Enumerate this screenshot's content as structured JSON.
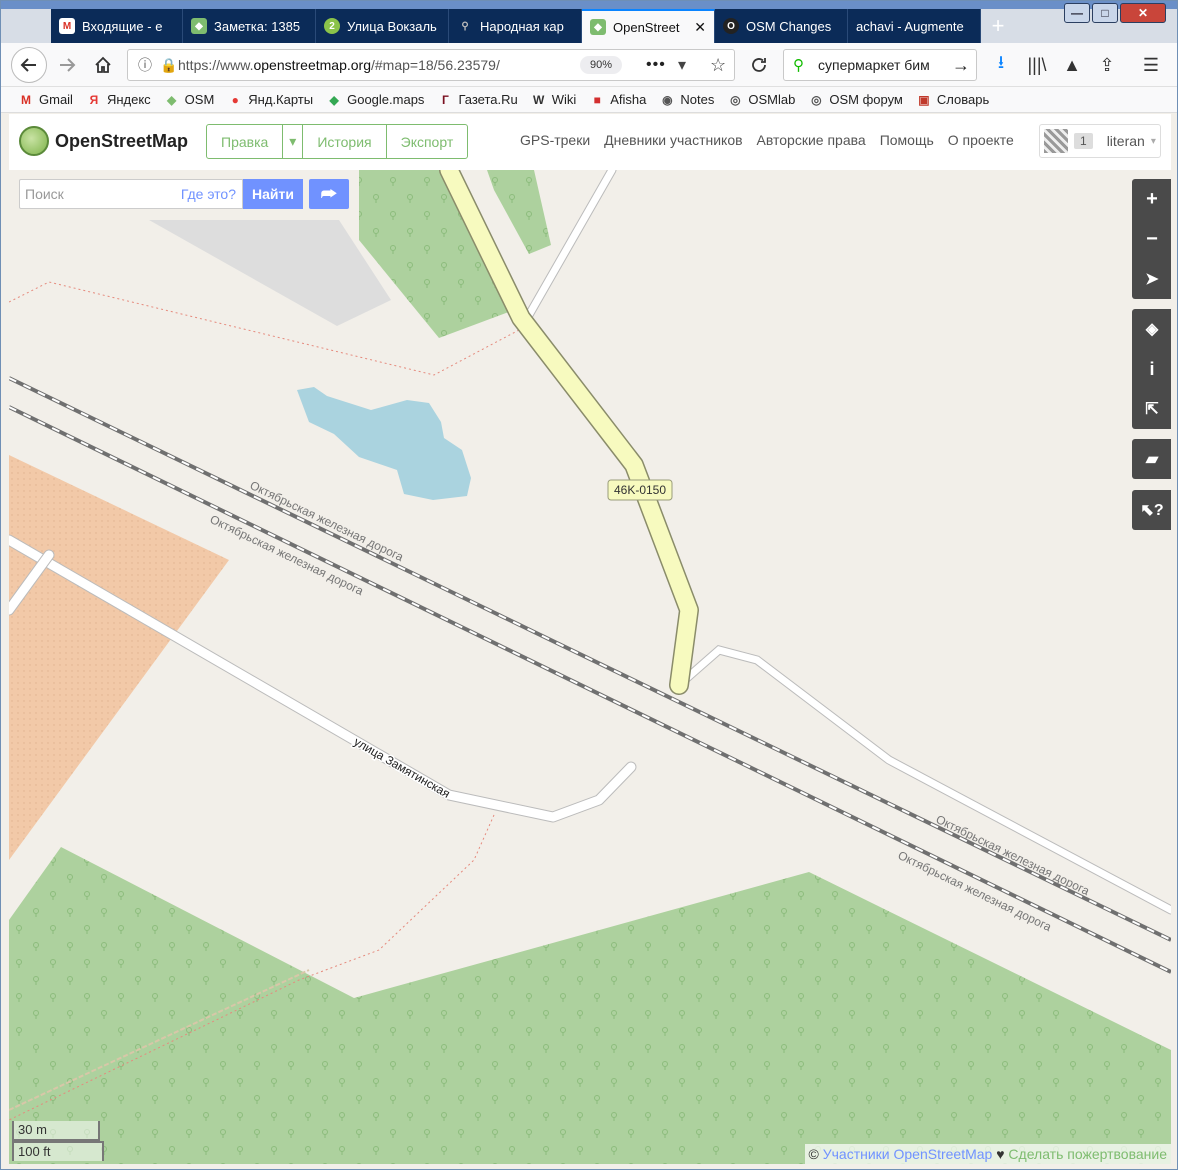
{
  "browser": {
    "tabs": [
      {
        "title": "Входящие - e",
        "icon": "gmail-icon",
        "color": "#d93025",
        "active": false
      },
      {
        "title": "Заметка: 1385",
        "icon": "osm-icon",
        "color": "#7ebc6f",
        "active": false
      },
      {
        "title": "Улица Вокзаль",
        "icon": "twogis-icon",
        "color": "#8bc34a",
        "active": false
      },
      {
        "title": "Народная кар",
        "icon": "pin-icon",
        "color": "#888888",
        "active": false
      },
      {
        "title": "OpenStreet",
        "icon": "osm-icon",
        "color": "#7ebc6f",
        "active": true
      },
      {
        "title": "OSM Changes",
        "icon": "osmcha-icon",
        "color": "#222222",
        "active": false
      },
      {
        "title": "achavi - Augmente",
        "icon": "blank-icon",
        "color": "#0b2b58",
        "active": false
      }
    ],
    "new_tab_symbol": "+",
    "window_buttons": {
      "minimize": "—",
      "maximize": "□",
      "close": "✕"
    },
    "url_prefix": "https://www.",
    "url_host": "openstreetmap.org",
    "url_rest": "/#map=18/56.23579/",
    "zoom": "90%",
    "search_value": "супермаркет бим",
    "bookmarks": [
      {
        "label": "Gmail",
        "icon": "gmail-icon",
        "glyph": "M",
        "color": "#d93025"
      },
      {
        "label": "Яндекс",
        "icon": "yandex-icon",
        "glyph": "Я",
        "color": "#e53935"
      },
      {
        "label": "OSM",
        "icon": "osm-icon",
        "glyph": "◆",
        "color": "#7ebc6f"
      },
      {
        "label": "Янд.Карты",
        "icon": "map-pin-icon",
        "glyph": "●",
        "color": "#e53935"
      },
      {
        "label": "Google.maps",
        "icon": "google-maps-icon",
        "glyph": "◆",
        "color": "#34a853"
      },
      {
        "label": "Газета.Ru",
        "icon": "gazeta-icon",
        "glyph": "Г",
        "color": "#7a1020"
      },
      {
        "label": "Wiki",
        "icon": "wikipedia-icon",
        "glyph": "W",
        "color": "#333333"
      },
      {
        "label": "Afisha",
        "icon": "afisha-icon",
        "glyph": "■",
        "color": "#d32f2f"
      },
      {
        "label": "Notes",
        "icon": "rss-icon",
        "glyph": "◉",
        "color": "#555555"
      },
      {
        "label": "OSMlab",
        "icon": "globe-icon",
        "glyph": "◎",
        "color": "#555555"
      },
      {
        "label": "OSM форум",
        "icon": "globe-icon",
        "glyph": "◎",
        "color": "#555555"
      },
      {
        "label": "Словарь",
        "icon": "dictionary-icon",
        "glyph": "▣",
        "color": "#c0392b"
      }
    ]
  },
  "osm": {
    "brand": "OpenStreetMap",
    "edit": "Правка",
    "history": "История",
    "export": "Экспорт",
    "nav": [
      "GPS-треки",
      "Дневники участников",
      "Авторские права",
      "Помощь",
      "О проекте"
    ],
    "user_count": "1",
    "username": "literan",
    "search_placeholder": "Поиск",
    "where_is_this": "Где это?",
    "go": "Найти"
  },
  "map": {
    "road_ref": "46K-0150",
    "railway_labels": [
      "Октябрьская железная дорога",
      "Октябрьская железная дорога",
      "Октябрьская железная дорога",
      "Октябрьская железная дорога"
    ],
    "street_label": "улица Замятинская",
    "scale_metric": "30 m",
    "scale_imperial": "100 ft",
    "attrib_symbol": "©",
    "attrib_contributors": "Участники OpenStreetMap",
    "attrib_heart": "♥",
    "attrib_donate": "Сделать пожертвование",
    "colors": {
      "forest": "#add19e",
      "water": "#aad3df",
      "residential": "#f2c9a8",
      "primary": "#f7fabf",
      "background": "#f2efe9"
    }
  }
}
